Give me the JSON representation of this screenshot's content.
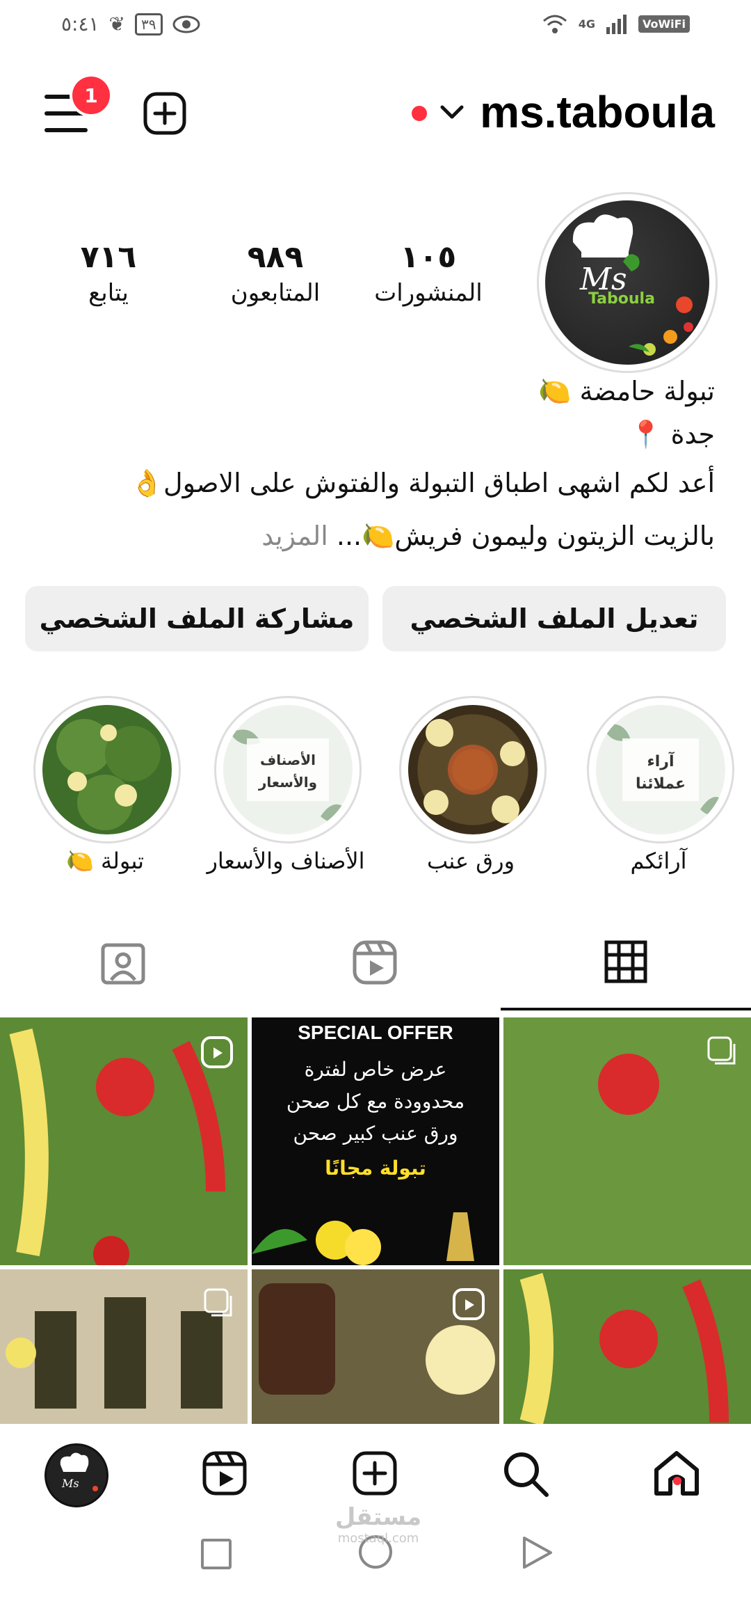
{
  "status_bar": {
    "time": "٥:٤١",
    "battery": "٣٩",
    "network": "4G",
    "wifi_calling": "VoWiFi"
  },
  "header": {
    "notifications_badge": "1",
    "username": "ms.taboula"
  },
  "profile": {
    "stats": [
      {
        "value": "١٠٥",
        "label": "المنشورات"
      },
      {
        "value": "٩٨٩",
        "label": "المتابعون"
      },
      {
        "value": "٧١٦",
        "label": "يتابع"
      }
    ],
    "name": "تبولة حامضة 🍋",
    "location": "جدة 📍",
    "bio_line1": "أعد لكم اشهى اطباق التبولة والفتوش على الاصول👌",
    "bio_line2": "بالزيت الزيتون وليمون فريش🍋...",
    "bio_more": "المزيد"
  },
  "actions": {
    "edit_profile": "تعديل الملف الشخصي",
    "share_profile": "مشاركة الملف الشخصي"
  },
  "highlights": [
    {
      "label": "آرائكم",
      "cover_text": "آراء عملائنا"
    },
    {
      "label": "ورق عنب",
      "cover_text": ""
    },
    {
      "label": "الأصناف والأسعار",
      "cover_text": "الأصناف والأسعار"
    },
    {
      "label": "تبولة 🍋",
      "cover_text": ""
    }
  ],
  "posts": {
    "special_offer_title": "SPECIAL OFFER",
    "offer_line1": "عرض خاص لفترة",
    "offer_line2": "محدوودة مع كل صحن",
    "offer_line3": "ورق عنب كبير صحن",
    "offer_line4": "تبولة مجانًا"
  },
  "watermark": {
    "brand": "مستقل",
    "domain": "mostaql.com"
  },
  "colors": {
    "accent_red": "#ff3040",
    "button_bg": "#efefef"
  }
}
